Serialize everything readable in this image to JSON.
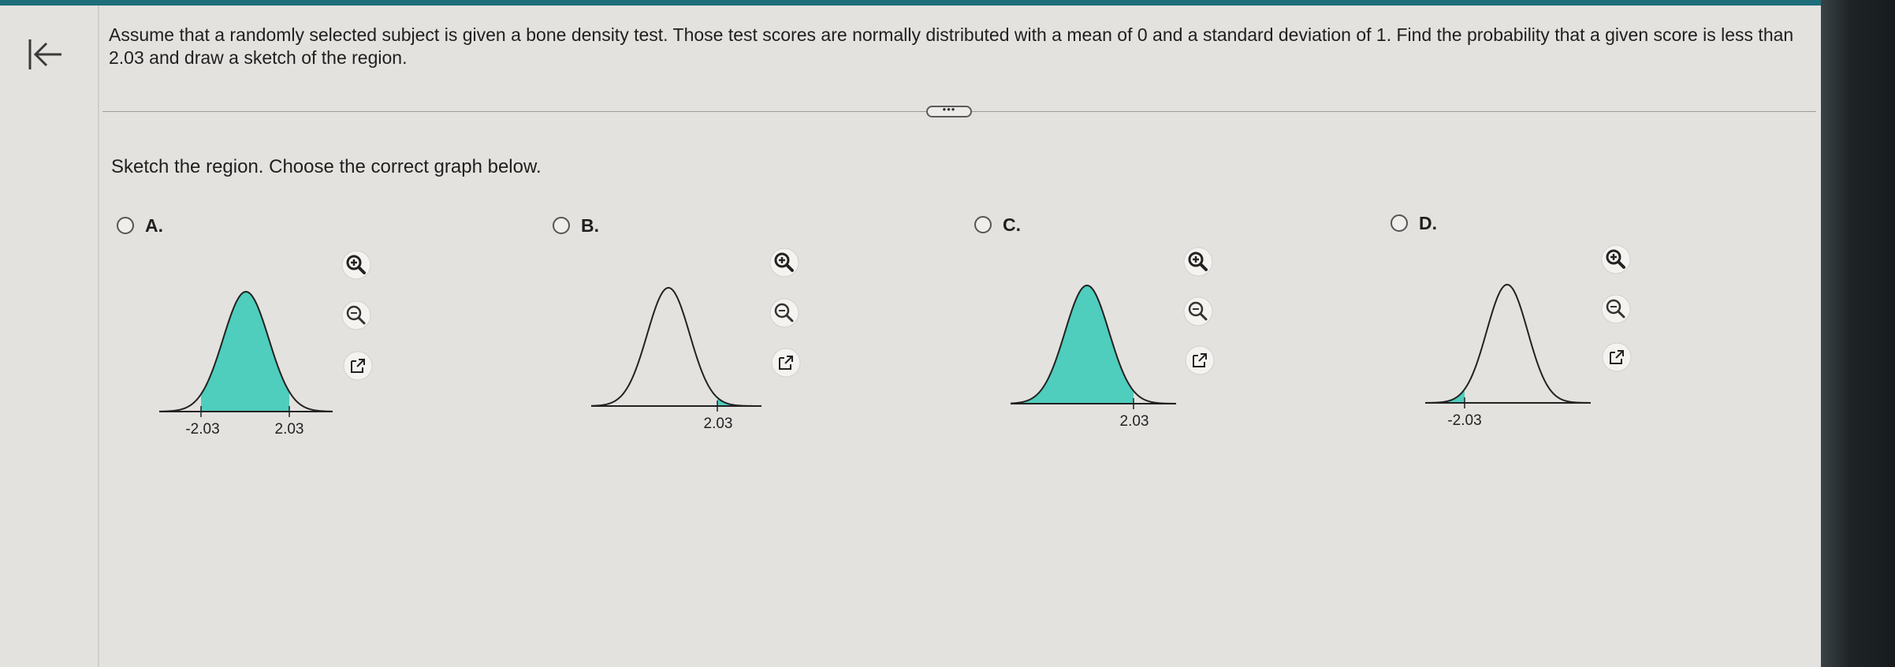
{
  "question": {
    "text": "Assume that a randomly selected subject is given a bone density test. Those test scores are normally distributed with a mean of 0 and a standard deviation of 1. Find the probability that a given score is less than 2.03 and draw a sketch of the region."
  },
  "more_button_label": "•••",
  "prompt": "Sketch the region. Choose the correct graph below.",
  "options": [
    {
      "letter": "A.",
      "shaded": "between",
      "labels": [
        "-2.03",
        "2.03"
      ]
    },
    {
      "letter": "B.",
      "shaded": "right-tail",
      "labels": [
        "2.03"
      ]
    },
    {
      "letter": "C.",
      "shaded": "left-of",
      "labels": [
        "2.03"
      ]
    },
    {
      "letter": "D.",
      "shaded": "left-tail",
      "labels": [
        "-2.03"
      ]
    }
  ],
  "icons": {
    "back": "back-to-start-icon",
    "zoom_in": "zoom-in-icon",
    "zoom_out": "zoom-out-icon",
    "popout": "open-in-new-window-icon"
  },
  "colors": {
    "shade": "#4fcdbd",
    "curve": "#222222",
    "screen": "#e3e2df"
  }
}
